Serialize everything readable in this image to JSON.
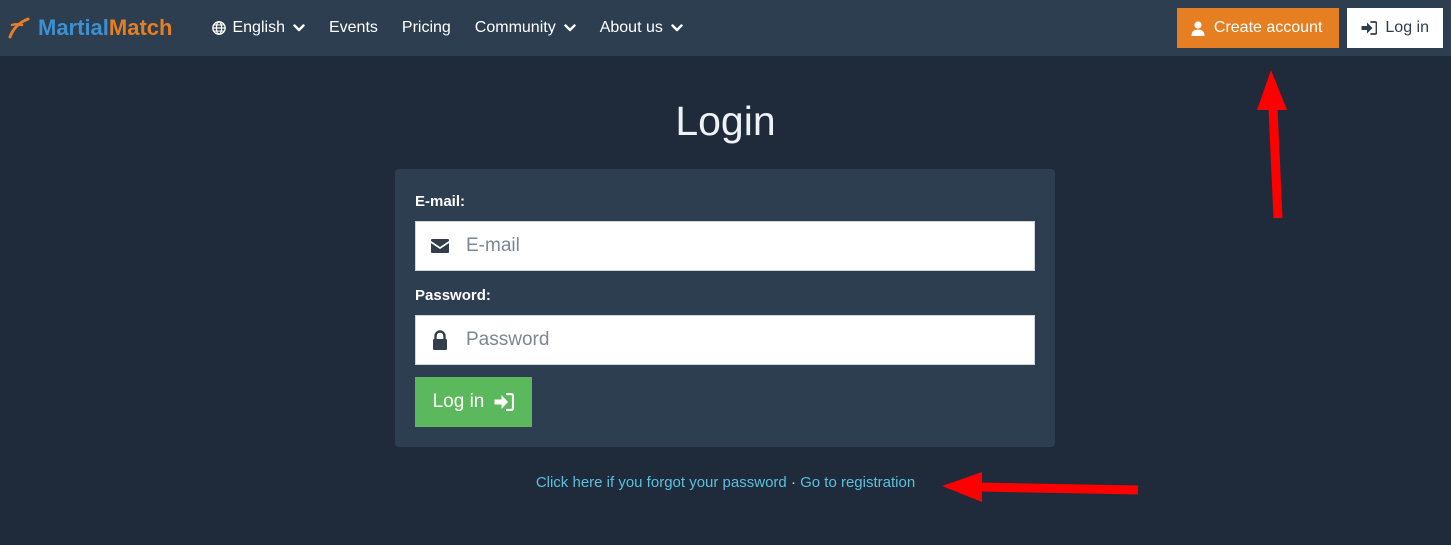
{
  "navbar": {
    "brand_part1": "Martial",
    "brand_part2": "Match",
    "language": "English",
    "items": [
      "Events",
      "Pricing",
      "Community",
      "About us"
    ],
    "create_account": "Create account",
    "log_in": "Log in"
  },
  "login": {
    "title": "Login",
    "email_label": "E-mail:",
    "email_placeholder": "E-mail",
    "email_value": "",
    "password_label": "Password:",
    "password_placeholder": "Password",
    "password_value": "",
    "submit_label": "Log in"
  },
  "links": {
    "forgot": "Click here if you forgot your password",
    "separator": "·",
    "register": "Go to registration"
  },
  "icons": {
    "globe": "globe-icon",
    "chevron": "chevron-down-icon",
    "user": "user-icon",
    "sign_in": "sign-in-icon",
    "envelope": "envelope-icon",
    "lock": "lock-icon"
  },
  "colors": {
    "background": "#1f2b3a",
    "navbar": "#2c3e50",
    "brand_blue": "#3d8fd1",
    "brand_orange": "#e67e22",
    "submit_green": "#5cb85c",
    "link": "#5bc0de",
    "annotation": "#ff0000"
  }
}
